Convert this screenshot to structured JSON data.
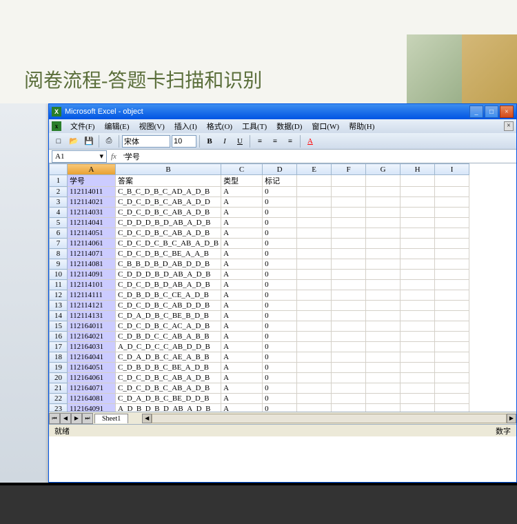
{
  "slide": {
    "title": "阅卷流程-答题卡扫描和识别"
  },
  "window": {
    "app_name": "Microsoft Excel",
    "doc_name": "object",
    "title": "Microsoft Excel - object"
  },
  "menus": [
    "文件(F)",
    "编辑(E)",
    "视图(V)",
    "插入(I)",
    "格式(O)",
    "工具(T)",
    "数据(D)",
    "窗口(W)",
    "帮助(H)"
  ],
  "font": {
    "name": "宋体",
    "size": "10"
  },
  "namebox": "A1",
  "formula": "'学号",
  "columns": [
    "A",
    "B",
    "C",
    "D",
    "E",
    "F",
    "G",
    "H",
    "I"
  ],
  "headers": [
    "学号",
    "答案",
    "类型",
    "标记"
  ],
  "rows": [
    [
      "112114011",
      "C_B_C_D_B_C_AD_A_D_B",
      "A",
      "0"
    ],
    [
      "112114021",
      "C_D_C_D_B_C_AB_A_D_D",
      "A",
      "0"
    ],
    [
      "112114031",
      "C_D_C_D_B_C_AB_A_D_B",
      "A",
      "0"
    ],
    [
      "112114041",
      "C_D_D_D_B_D_AB_A_D_B",
      "A",
      "0"
    ],
    [
      "112114051",
      "C_D_C_D_B_C_AB_A_D_B",
      "A",
      "0"
    ],
    [
      "112114061",
      "C_D_C_D_C_B_C_AB_A_D_B",
      "A",
      "0"
    ],
    [
      "112114071",
      "C_D_C_D_B_C_BE_A_A_B",
      "A",
      "0"
    ],
    [
      "112114081",
      "C_B_B_D_B_D_AB_D_D_B",
      "A",
      "0"
    ],
    [
      "112114091",
      "C_D_D_D_B_D_AB_A_D_B",
      "A",
      "0"
    ],
    [
      "112114101",
      "C_D_C_D_B_D_AB_A_D_B",
      "A",
      "0"
    ],
    [
      "112114111",
      "C_D_B_D_B_C_CE_A_D_B",
      "A",
      "0"
    ],
    [
      "112114121",
      "C_D_C_D_B_C_AB_D_D_B",
      "A",
      "0"
    ],
    [
      "112114131",
      "C_D_A_D_B_C_BE_B_D_B",
      "A",
      "0"
    ],
    [
      "112164011",
      "C_D_C_D_B_C_AC_A_D_B",
      "A",
      "0"
    ],
    [
      "112164021",
      "C_D_B_D_C_C_AB_A_B_B",
      "A",
      "0"
    ],
    [
      "112164031",
      "A_D_C_D_C_C_AB_D_D_B",
      "A",
      "0"
    ],
    [
      "112164041",
      "C_D_A_D_B_C_AE_A_B_B",
      "A",
      "0"
    ],
    [
      "112164051",
      "C_D_B_D_B_C_BE_A_D_B",
      "A",
      "0"
    ],
    [
      "112164061",
      "C_D_C_D_B_C_AB_A_D_B",
      "A",
      "0"
    ],
    [
      "112164071",
      "C_D_C_D_B_C_AB_A_D_B",
      "A",
      "0"
    ],
    [
      "112164081",
      "C_D_A_D_B_C_BE_D_D_B",
      "A",
      "0"
    ],
    [
      "112164091",
      "A_D_B_D_B_D_AB_A_D_B",
      "A",
      "0"
    ]
  ],
  "sheet_tab": "Sheet1",
  "status": {
    "left": "就绪",
    "right": "数字"
  }
}
